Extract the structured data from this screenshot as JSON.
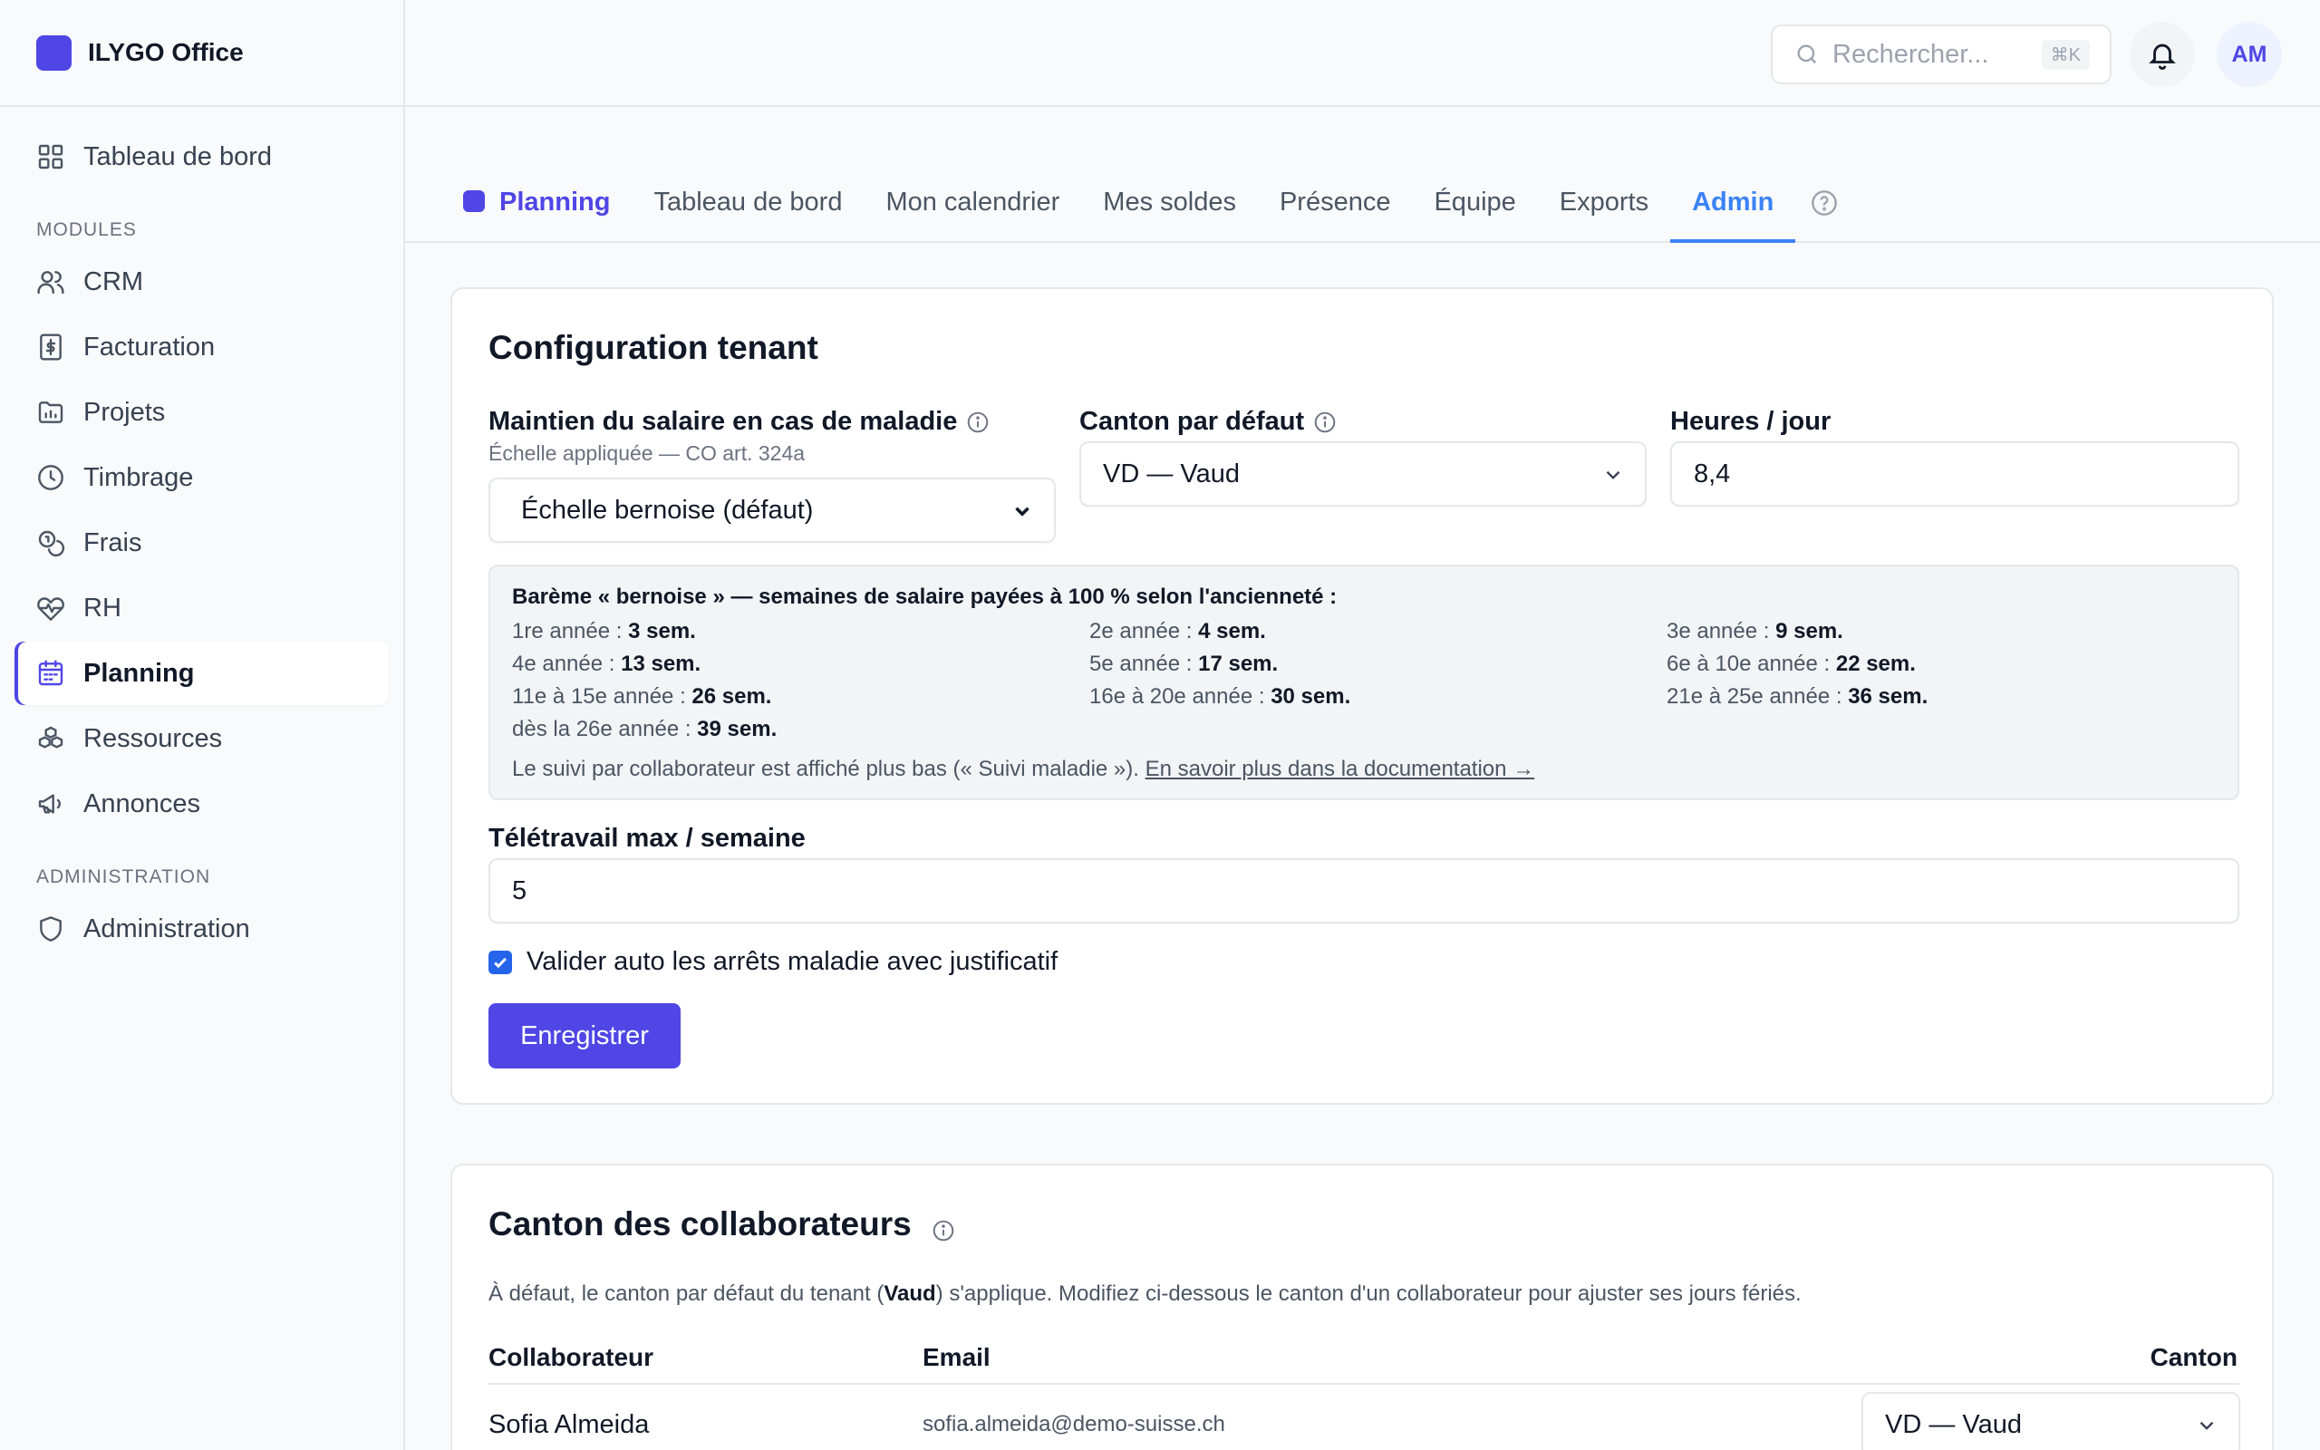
{
  "app": {
    "name": "ILYGO Office"
  },
  "sidebar": {
    "top_item": "Tableau de bord",
    "section_modules": "MODULES",
    "modules": [
      {
        "label": "CRM",
        "icon": "users-icon"
      },
      {
        "label": "Facturation",
        "icon": "invoice-icon"
      },
      {
        "label": "Projets",
        "icon": "folder-chart-icon"
      },
      {
        "label": "Timbrage",
        "icon": "clock-icon"
      },
      {
        "label": "Frais",
        "icon": "coins-icon"
      },
      {
        "label": "RH",
        "icon": "heart-pulse-icon"
      },
      {
        "label": "Planning",
        "icon": "calendar-icon",
        "active": true
      },
      {
        "label": "Ressources",
        "icon": "boxes-icon"
      },
      {
        "label": "Annonces",
        "icon": "megaphone-icon"
      }
    ],
    "section_admin": "ADMINISTRATION",
    "admin_items": [
      {
        "label": "Administration",
        "icon": "shield-icon"
      }
    ]
  },
  "topbar": {
    "search_placeholder": "Rechercher...",
    "search_shortcut": "⌘K",
    "avatar_initials": "AM"
  },
  "tabs": {
    "module": "Planning",
    "items": [
      "Tableau de bord",
      "Mon calendrier",
      "Mes soldes",
      "Présence",
      "Équipe",
      "Exports",
      "Admin"
    ],
    "active": "Admin"
  },
  "config": {
    "title": "Configuration tenant",
    "maintien": {
      "label": "Maintien du salaire en cas de maladie",
      "sublabel": "Échelle appliquée — CO art. 324a",
      "value": "Échelle bernoise (défaut)"
    },
    "canton": {
      "label": "Canton par défaut",
      "value": "VD — Vaud"
    },
    "heures": {
      "label": "Heures / jour",
      "value": "8,4"
    },
    "bareme": {
      "title": "Barème « bernoise » — semaines de salaire payées à 100 % selon l'ancienneté :",
      "rows": [
        {
          "label": "1re année :",
          "value": "3 sem."
        },
        {
          "label": "2e année :",
          "value": "4 sem."
        },
        {
          "label": "3e année :",
          "value": "9 sem."
        },
        {
          "label": "4e année :",
          "value": "13 sem."
        },
        {
          "label": "5e année :",
          "value": "17 sem."
        },
        {
          "label": "6e à 10e année :",
          "value": "22 sem."
        },
        {
          "label": "11e à 15e année :",
          "value": "26 sem."
        },
        {
          "label": "16e à 20e année :",
          "value": "30 sem."
        },
        {
          "label": "21e à 25e année :",
          "value": "36 sem."
        },
        {
          "label": "dès la 26e année :",
          "value": "39 sem."
        }
      ],
      "footer_text": "Le suivi par collaborateur est affiché plus bas (« Suivi maladie »).",
      "footer_link": "En savoir plus dans la documentation →"
    },
    "teletravail": {
      "label": "Télétravail max / semaine",
      "value": "5"
    },
    "auto_validate": {
      "label": "Valider auto les arrêts maladie avec justificatif",
      "checked": true
    },
    "save_label": "Enregistrer"
  },
  "collaborateurs": {
    "title": "Canton des collaborateurs",
    "desc_prefix": "À défaut, le canton par défaut du tenant (",
    "desc_bold": "Vaud",
    "desc_suffix": ") s'applique. Modifiez ci-dessous le canton d'un collaborateur pour ajuster ses jours fériés.",
    "columns": [
      "Collaborateur",
      "Email",
      "Canton"
    ],
    "rows": [
      {
        "name": "Sofia Almeida",
        "email": "sofia.almeida@demo-suisse.ch",
        "canton": "VD — Vaud"
      }
    ]
  },
  "colors": {
    "accent": "#4f46e5",
    "tab_active": "#3b82f6"
  }
}
